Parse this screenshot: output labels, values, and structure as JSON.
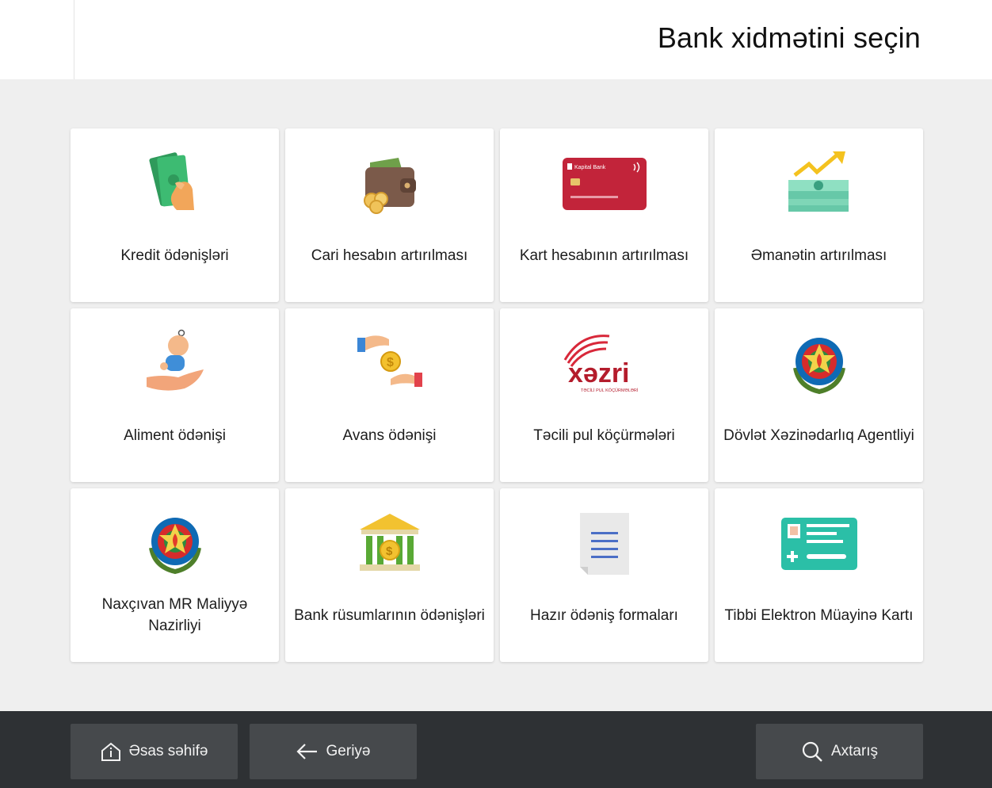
{
  "header": {
    "title": "Bank xidmətini seçin"
  },
  "tiles": [
    {
      "label": "Kredit ödənişləri",
      "icon": "money-hand-icon"
    },
    {
      "label": "Cari hesabın artırılması",
      "icon": "wallet-coins-icon"
    },
    {
      "label": "Kart hesabının artırılması",
      "icon": "bank-card-icon",
      "card_brand": "Kapital Bank"
    },
    {
      "label": "Əmanətin artırılması",
      "icon": "money-growth-icon"
    },
    {
      "label": "Aliment ödənişi",
      "icon": "baby-hand-icon"
    },
    {
      "label": "Avans ödənişi",
      "icon": "coin-exchange-hands-icon"
    },
    {
      "label": "Təcili pul köçürmələri",
      "icon": "xezri-logo-icon",
      "logo_text": "xəzri",
      "logo_subtext": "TƏCİLİ PUL KÖÇÜRMƏLƏRİ"
    },
    {
      "label": "Dövlət Xəzinədarlıq Agentliyi",
      "icon": "azerbaijan-emblem-icon"
    },
    {
      "label": "Naxçıvan MR Maliyyə Nazirliyi",
      "icon": "azerbaijan-emblem-icon"
    },
    {
      "label": "Bank rüsumlarının ödənişləri",
      "icon": "bank-building-icon"
    },
    {
      "label": "Hazır ödəniş formaları",
      "icon": "document-form-icon"
    },
    {
      "label": "Tibbi Elektron Müayinə Kartı",
      "icon": "medical-card-icon"
    }
  ],
  "footer": {
    "home_label": "Əsas səhifə",
    "back_label": "Geriyə",
    "search_label": "Axtarış"
  },
  "colors": {
    "background": "#efefef",
    "footer": "#2e3134",
    "footer_button": "#46494c"
  }
}
